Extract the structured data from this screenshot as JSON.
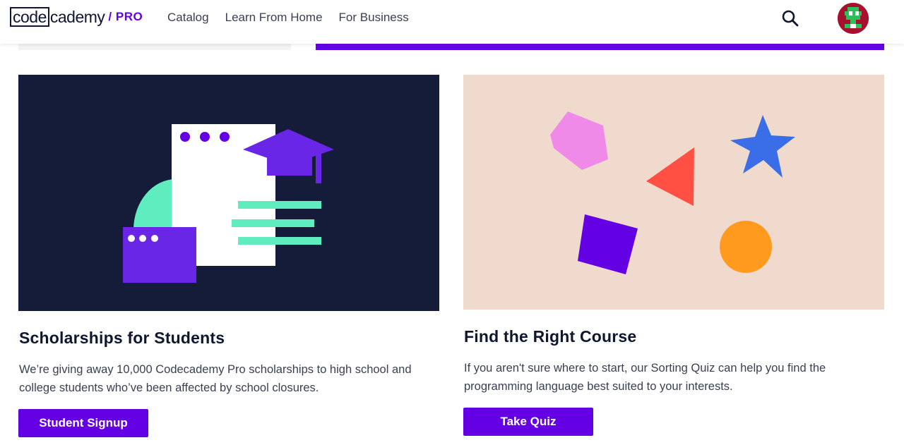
{
  "header": {
    "logo": {
      "box_text": "code",
      "rest_text": "cademy",
      "pro_label": "/ PRO"
    },
    "nav": [
      {
        "label": "Catalog"
      },
      {
        "label": "Learn From Home"
      },
      {
        "label": "For Business"
      }
    ],
    "icons": {
      "search": "search-icon",
      "avatar": "user-avatar"
    }
  },
  "cards": [
    {
      "title": "Scholarships for Students",
      "description": "We’re giving away 10,000 Codecademy Pro scholarships to high school and college students who’ve been affected by school closures.",
      "button_label": "Student Signup",
      "illustration": "graduation-cap-document-illustration"
    },
    {
      "title": "Find the Right Course",
      "description": "If you aren't sure where to start, our Sorting Quiz can help you find the programming language best suited to your interests.",
      "button_label": "Take Quiz",
      "illustration": "geometric-shapes-illustration"
    }
  ],
  "colors": {
    "brand": "#6400e4",
    "navy": "#141c3a",
    "peach": "#f0dacd",
    "mint": "#5fedbf",
    "pink": "#f08ae8",
    "red": "#ff5043",
    "blue": "#3a6ee8",
    "orange": "#ff9a1f"
  }
}
